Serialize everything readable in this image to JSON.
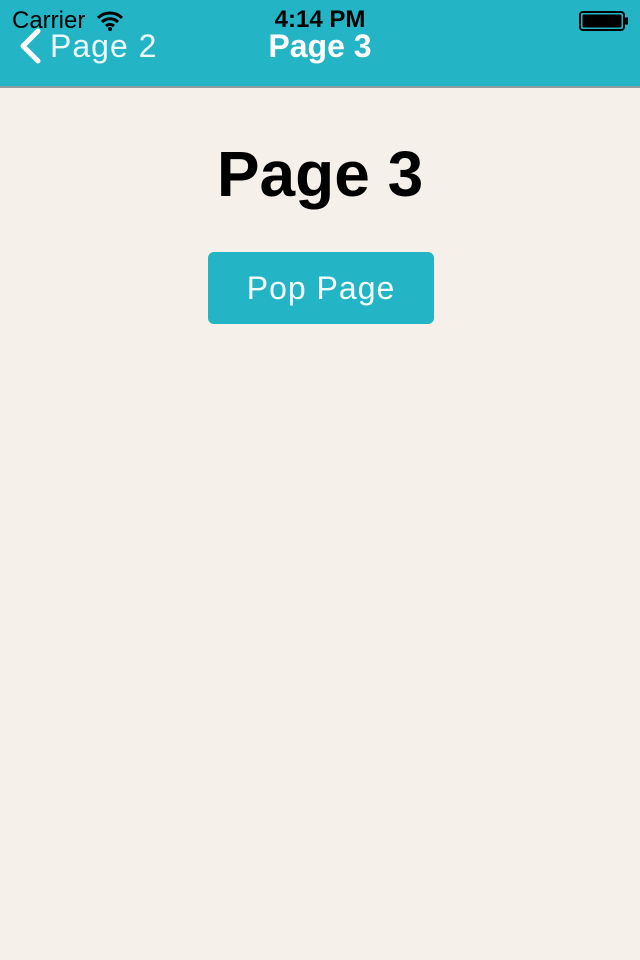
{
  "status_bar": {
    "carrier": "Carrier",
    "time": "4:14 PM",
    "wifi_icon": "wifi-icon",
    "battery_icon": "battery-icon"
  },
  "nav_bar": {
    "back_label": "Page 2",
    "back_icon": "chevron-left-icon",
    "title": "Page 3",
    "background_color": "#23b4c6"
  },
  "content": {
    "heading": "Page 3",
    "pop_button_label": "Pop Page",
    "background_color": "#f5f0e9"
  }
}
